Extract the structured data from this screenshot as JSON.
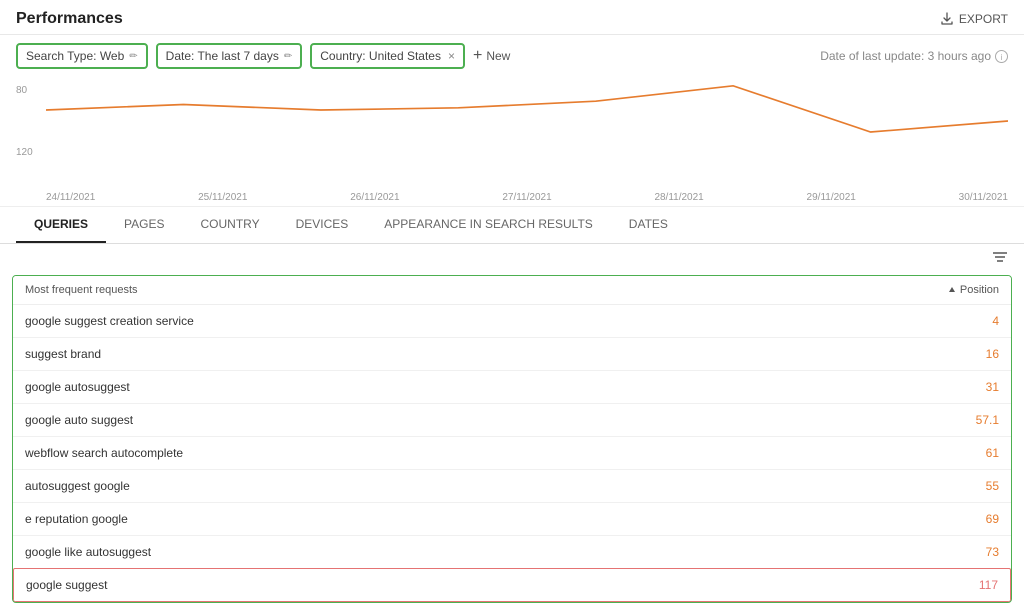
{
  "header": {
    "title": "Performances",
    "export_label": "EXPORT"
  },
  "filters": {
    "chips": [
      {
        "label": "Search Type: Web",
        "editable": true,
        "closable": false
      },
      {
        "label": "Date: The last 7 days",
        "editable": true,
        "closable": false
      },
      {
        "label": "Country: United States",
        "editable": false,
        "closable": true
      }
    ],
    "new_label": "New",
    "date_update": "Date of last update: 3 hours ago"
  },
  "chart": {
    "y_labels": [
      "80",
      "120"
    ],
    "dates": [
      "24/11/2021",
      "25/11/2021",
      "26/11/2021",
      "27/11/2021",
      "28/11/2021",
      "29/11/2021",
      "30/11/2021"
    ]
  },
  "tabs": [
    {
      "label": "QUERIES",
      "active": true
    },
    {
      "label": "PAGES",
      "active": false
    },
    {
      "label": "COUNTRY",
      "active": false
    },
    {
      "label": "DEVICES",
      "active": false
    },
    {
      "label": "APPEARANCE IN SEARCH RESULTS",
      "active": false
    },
    {
      "label": "DATES",
      "active": false
    }
  ],
  "table": {
    "header_left": "Most frequent requests",
    "header_right": "Position",
    "rows": [
      {
        "text": "google suggest creation service",
        "value": "4"
      },
      {
        "text": "suggest brand",
        "value": "16"
      },
      {
        "text": "google autosuggest",
        "value": "31"
      },
      {
        "text": "google auto suggest",
        "value": "57.1"
      },
      {
        "text": "webflow search autocomplete",
        "value": "61"
      },
      {
        "text": "autosuggest google",
        "value": "55"
      },
      {
        "text": "e reputation google",
        "value": "69"
      },
      {
        "text": "google like autosuggest",
        "value": "73"
      }
    ],
    "last_row": {
      "text": "google suggest",
      "value": "117"
    }
  }
}
